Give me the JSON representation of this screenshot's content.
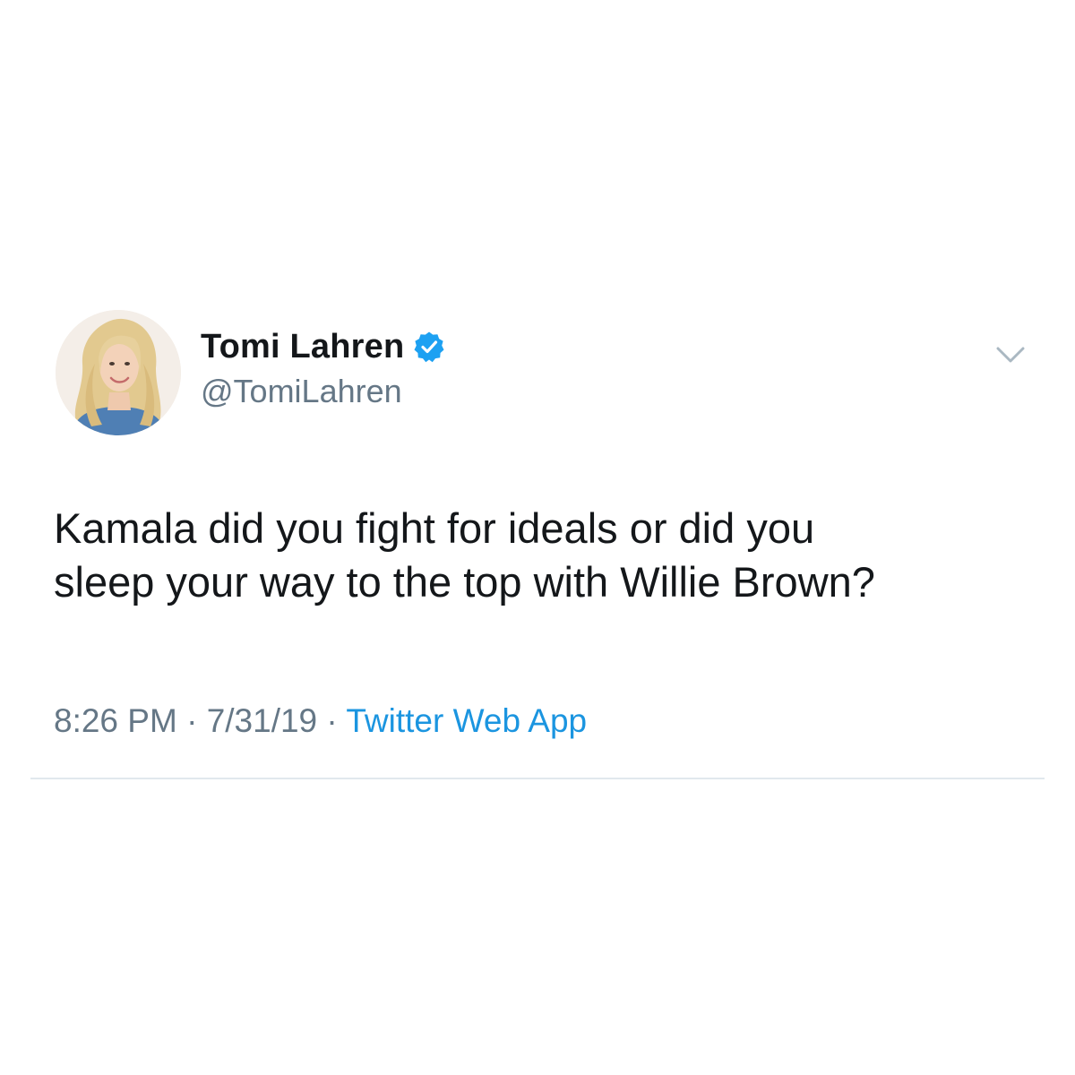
{
  "tweet": {
    "display_name": "Tomi Lahren",
    "handle": "@TomiLahren",
    "verified_icon": "verified-badge-icon",
    "menu_icon": "chevron-down-icon",
    "text_lines": [
      "Kamala did you fight for ideals or did you",
      "sleep your way to the top with Willie Brown?"
    ],
    "time": "8:26 PM",
    "separator": "·",
    "date": "7/31/19",
    "source": "Twitter Web App"
  },
  "colors": {
    "text_primary": "#14171a",
    "text_secondary": "#657786",
    "link": "#1b95e0",
    "verified": "#1da1f2",
    "divider": "#e1e8ed",
    "chevron": "#aab8c2"
  }
}
